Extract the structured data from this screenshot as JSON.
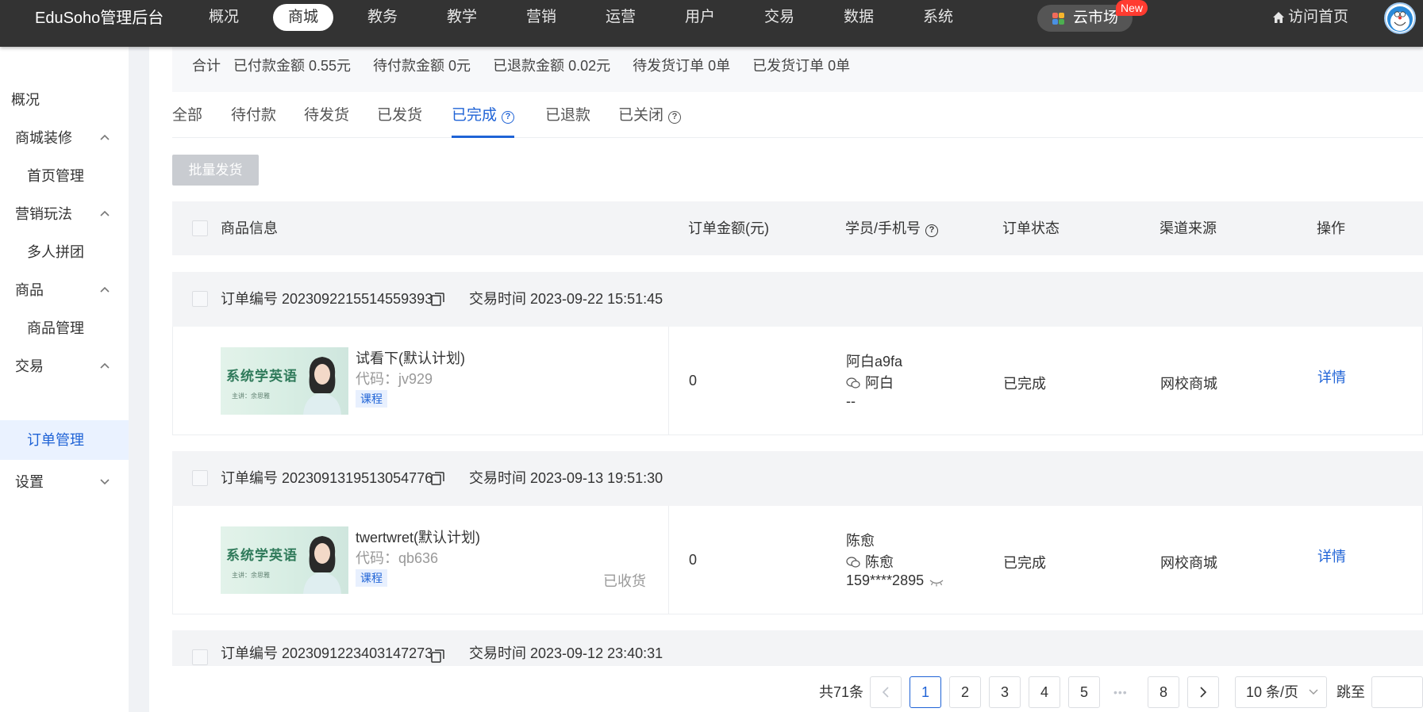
{
  "brand": "EduSoho管理后台",
  "nav": [
    "概况",
    "商城",
    "教务",
    "教学",
    "营销",
    "运营",
    "用户",
    "交易",
    "数据",
    "系统"
  ],
  "cloud_market": {
    "label": "云市场",
    "badge": "New"
  },
  "home_link": "访问首页",
  "sidebar": {
    "overview": "概况",
    "mall_decor": "商城装修",
    "home_manage": "首页管理",
    "marketing": "营销玩法",
    "group_buy": "多人拼团",
    "goods": "商品",
    "goods_manage": "商品管理",
    "trade": "交易",
    "order_manage": "订单管理",
    "settings": "设置"
  },
  "summary": {
    "label": "合计",
    "paid": "已付款金额 0.55元",
    "pending_pay": "待付款金额 0元",
    "refunded": "已退款金额 0.02元",
    "pending_ship": "待发货订单 0单",
    "shipped": "已发货订单 0单"
  },
  "tabs": [
    "全部",
    "待付款",
    "待发货",
    "已发货",
    "已完成",
    "已退款",
    "已关闭"
  ],
  "batch_ship": "批量发货",
  "table_headers": {
    "goods": "商品信息",
    "amount": "订单金额(元)",
    "student": "学员/手机号",
    "status": "订单状态",
    "channel": "渠道来源",
    "action": "操作"
  },
  "thumb_text": {
    "title": "系统学英语",
    "sub": "主讲：余思雅"
  },
  "orders": [
    {
      "number": "订单编号 2023092215514559393",
      "time": "交易时间 2023-09-22 15:51:45",
      "product": "试看下(默认计划)",
      "code": "代码：jv929",
      "tag": "课程",
      "amount": "0",
      "student": "阿白a9fa",
      "wechat": "阿白",
      "phone": "--",
      "status": "已完成",
      "channel": "网校商城",
      "action": "详情",
      "extra": ""
    },
    {
      "number": "订单编号 2023091319513054776",
      "time": "交易时间 2023-09-13 19:51:30",
      "product": "twertwret(默认计划)",
      "code": "代码：qb636",
      "tag": "课程",
      "amount": "0",
      "student": "陈愈",
      "wechat": "陈愈",
      "phone": "159****2895",
      "status": "已完成",
      "channel": "网校商城",
      "action": "详情",
      "extra": "已收货"
    },
    {
      "number": "订单编号 2023091223403147273",
      "time": "交易时间 2023-09-12 23:40:31"
    }
  ],
  "pagination": {
    "total": "共71条",
    "pages": [
      "1",
      "2",
      "3",
      "4",
      "5",
      "8"
    ],
    "ellipsis": "•••",
    "page_size": "10 条/页",
    "jump": "跳至"
  },
  "colors": {
    "primary": "#1f63d6",
    "topbar": "#333333",
    "badge": "#ff3b30"
  }
}
